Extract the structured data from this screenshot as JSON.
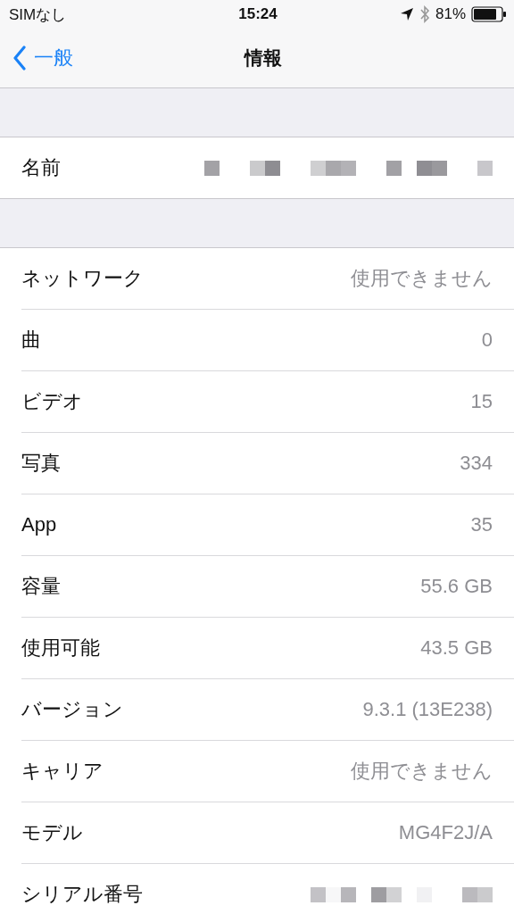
{
  "status_bar": {
    "carrier": "SIMなし",
    "time": "15:24",
    "battery": "81%"
  },
  "nav": {
    "back": "一般",
    "title": "情報"
  },
  "sections": [
    {
      "rows": [
        {
          "label": "名前",
          "redacted": true
        }
      ]
    },
    {
      "rows": [
        {
          "label": "ネットワーク",
          "value": "使用できません"
        },
        {
          "label": "曲",
          "value": "0"
        },
        {
          "label": "ビデオ",
          "value": "15"
        },
        {
          "label": "写真",
          "value": "334"
        },
        {
          "label": "App",
          "value": "35"
        },
        {
          "label": "容量",
          "value": "55.6 GB"
        },
        {
          "label": "使用可能",
          "value": "43.5 GB"
        },
        {
          "label": "バージョン",
          "value": "9.3.1 (13E238)"
        },
        {
          "label": "キャリア",
          "value": "使用できません"
        },
        {
          "label": "モデル",
          "value": "MG4F2J/A"
        },
        {
          "label": "シリアル番号",
          "redacted": true
        }
      ]
    }
  ]
}
